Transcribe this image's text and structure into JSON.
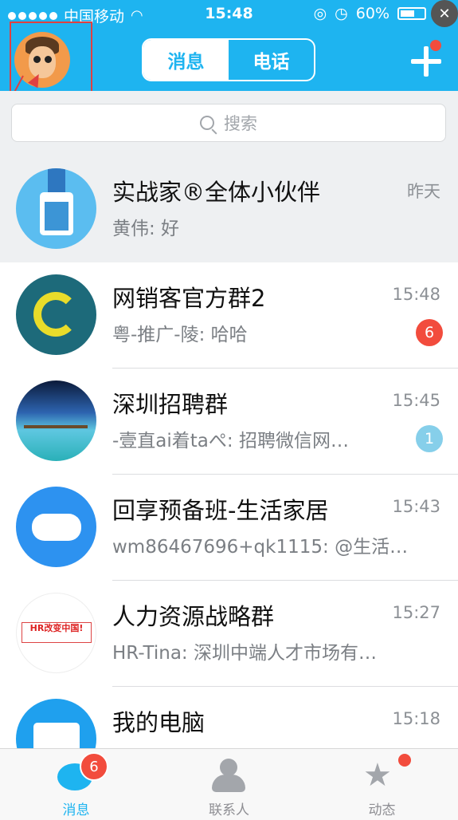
{
  "status_bar": {
    "carrier": "中国移动",
    "time": "15:48",
    "battery": "60%",
    "battery_level": 0.6
  },
  "header": {
    "tabs": [
      {
        "label": "消息",
        "active": true
      },
      {
        "label": "电话",
        "active": false
      }
    ]
  },
  "search": {
    "placeholder": "搜索"
  },
  "conversations": [
    {
      "name": "实战家®全体小伙伴",
      "preview": "黄伟: 好",
      "time": "昨天",
      "badge": "",
      "avatar": "id-badge-icon",
      "pinned": true
    },
    {
      "name": "网销客官方群2",
      "preview": "粤-推广-陵: 哈哈",
      "time": "15:48",
      "badge": "6",
      "badge_color": "#f24c3d",
      "avatar": "monkey-logo"
    },
    {
      "name": "深圳招聘群",
      "preview": "-壹直ai着taぺ: 招聘微信网…",
      "time": "15:45",
      "badge": "1",
      "badge_color": "#86cfea",
      "avatar": "seaside-photo"
    },
    {
      "name": "回享预备班-生活家居",
      "preview": "wm86467696+qk1115: @生活…",
      "time": "15:43",
      "badge": "",
      "avatar": "gamepad-icon"
    },
    {
      "name": "人力资源战略群",
      "preview": "HR-Tina: 深圳中端人才市场有…",
      "time": "15:27",
      "badge": "",
      "avatar": "hr-logo",
      "avatar_text": "HR改变中国!"
    },
    {
      "name": "我的电脑",
      "preview": "",
      "time": "15:18",
      "badge": "",
      "avatar": "computer-icon"
    }
  ],
  "tabbar": {
    "items": [
      {
        "label": "消息",
        "badge": "6",
        "active": true
      },
      {
        "label": "联系人",
        "badge": "",
        "active": false
      },
      {
        "label": "动态",
        "badge": "",
        "dot": true,
        "active": false
      }
    ]
  },
  "colors": {
    "accent": "#1eb4f0",
    "badge_red": "#f24c3d",
    "badge_light": "#86cfea"
  }
}
